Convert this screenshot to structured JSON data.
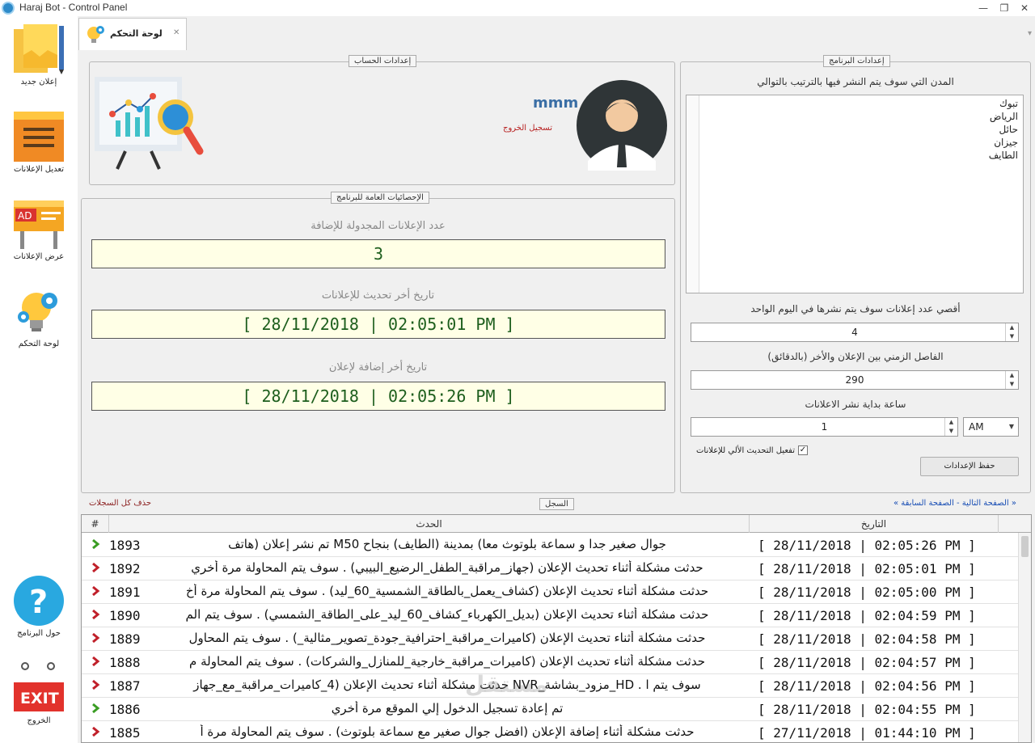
{
  "window": {
    "title": "Haraj Bot - Control Panel",
    "minimize": "—",
    "maximize": "❐",
    "close": "✕"
  },
  "sidebar": {
    "items": [
      {
        "label": "إعلان جديد"
      },
      {
        "label": "تعديل الإعلانات"
      },
      {
        "label": "عرض الإعلانات",
        "ad_text": "AD"
      },
      {
        "label": "لوحة التحكم"
      },
      {
        "label": "حول البرنامج"
      },
      {
        "label": "الخروج",
        "exit_text": "EXIT"
      }
    ]
  },
  "tab": {
    "label": "لوحة التحكم",
    "close": "✕"
  },
  "account": {
    "legend": "إعدادات الحساب",
    "username": "mmm",
    "logout": "تسجيل الخروج"
  },
  "stats": {
    "legend": "الإحصائيات العامة للبرنامج",
    "scheduled_label": "عدد الإعلانات المجدولة للإضافة",
    "scheduled_value": "3",
    "last_update_label": "تاريخ أخر تحديث للإعلانات",
    "last_update_value": "[ 28/11/2018 | 02:05:01 PM ]",
    "last_add_label": "تاريخ أخر إضافة لإعلان",
    "last_add_value": "[ 28/11/2018 | 02:05:26 PM ]"
  },
  "settings": {
    "legend": "إعدادات البرنامج",
    "cities_label": "المدن التي سوف يتم النشر فيها بالترتيب بالتوالي",
    "cities": [
      "تبوك",
      "الرياض",
      "حائل",
      "جيزان",
      "الطايف"
    ],
    "max_ads_label": "أقصي عدد إعلانات سوف يتم نشرها في اليوم الواحد",
    "max_ads_value": "4",
    "interval_label": "الفاصل الزمني بين الإعلان والأخر (بالدقائق)",
    "interval_value": "290",
    "start_hour_label": "ساعة بداية نشر الاعلانات",
    "start_hour_value": "1",
    "ampm_value": "AM",
    "auto_update_label": "تفعيل التحديث الألي للإعلانات",
    "auto_update_checked": true,
    "save_label": "حفظ الإعدادات"
  },
  "log": {
    "legend": "السجل",
    "pager": "« الصفحة التالية - الصفحة السابقة »",
    "delete_all": "حذف كل السجلات",
    "columns": {
      "num": "#",
      "event": "الحدث",
      "date": "التاريخ"
    },
    "rows": [
      {
        "num": "1893",
        "status": "success",
        "event": "جوال صغير جدا و سماعة بلوتوث معا) بمدينة (الطايف) بنجاح M50 تم نشر إعلان (هاتف",
        "date": "[ 28/11/2018 | 02:05:26 PM ]"
      },
      {
        "num": "1892",
        "status": "error",
        "event": "حدثت مشكلة أثناء تحديث الإعلان (جهاز_مراقبة_الطفل_الرضيع_البيبي) . سوف يتم المحاولة مرة أخري",
        "date": "[ 28/11/2018 | 02:05:01 PM ]"
      },
      {
        "num": "1891",
        "status": "error",
        "event": "حدثت مشكلة أثناء تحديث الإعلان (كشاف_يعمل_بالطاقة_الشمسية_60_ليد) . سوف يتم المحاولة مرة أخ",
        "date": "[ 28/11/2018 | 02:05:00 PM ]"
      },
      {
        "num": "1890",
        "status": "error",
        "event": "حدثت مشكلة أثناء تحديث الإعلان (بديل_الكهرباء_كشاف_60_ليد_على_الطاقة_الشمسي) . سوف يتم الم",
        "date": "[ 28/11/2018 | 02:04:59 PM ]"
      },
      {
        "num": "1889",
        "status": "error",
        "event": "حدثت مشكلة أثناء تحديث الإعلان (كاميرات_مراقبة_احترافية_جودة_تصوير_مثالية_) . سوف يتم المحاول",
        "date": "[ 28/11/2018 | 02:04:58 PM ]"
      },
      {
        "num": "1888",
        "status": "error",
        "event": "حدثت مشكلة أثناء تحديث الإعلان (كاميرات_مراقبة_خارجية_للمنازل_والشركات) . سوف يتم المحاولة م",
        "date": "[ 28/11/2018 | 02:04:57 PM ]"
      },
      {
        "num": "1887",
        "status": "error",
        "event": "سوف يتم ا . HD_مزود_بشاشة_NVR حدثت مشكلة أثناء تحديث الإعلان (4_كاميرات_مراقبة_مع_جهاز",
        "date": "[ 28/11/2018 | 02:04:56 PM ]"
      },
      {
        "num": "1886",
        "status": "success",
        "event": "تم إعادة تسجيل الدخول إلي الموقع مرة أخري",
        "date": "[ 28/11/2018 | 02:04:55 PM ]"
      },
      {
        "num": "1885",
        "status": "error",
        "event": "حدثت مشكلة أثناء إضافة الإعلان (افضل جوال صغير مع سماعة بلوتوث) . سوف يتم المحاولة مرة أ",
        "date": "[ 27/11/2018 | 01:44:10 PM ]"
      }
    ]
  },
  "watermark": "مستقل",
  "colors": {
    "success": "#3a9d23",
    "error": "#c0202a",
    "stat_text": "#1d5e1d",
    "stat_bg": "#ffffe6"
  }
}
